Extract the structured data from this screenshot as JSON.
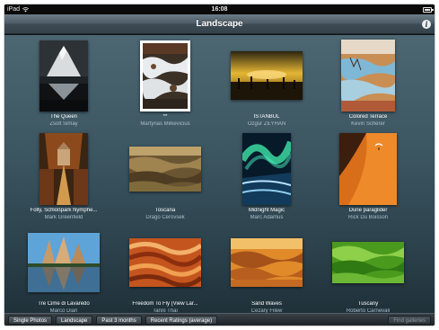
{
  "statusbar": {
    "carrier": "iPad",
    "time": "16:08"
  },
  "navbar": {
    "title": "Landscape",
    "info_icon": "i"
  },
  "photos": [
    {
      "title": "The Queen",
      "author": "Zsolt Simay"
    },
    {
      "title": "**",
      "author": "Martynas Milkevicius"
    },
    {
      "title": "İSTANBUL",
      "author": "Özgür ZEYHAN"
    },
    {
      "title": "Colored Terrace",
      "author": "Kevin Scherer"
    },
    {
      "title": "Folly, Schloßpark Nymphe...",
      "author": "Mark Greenfield"
    },
    {
      "title": "Toscana",
      "author": "Drago Cerovsek"
    },
    {
      "title": "Midnight Magic",
      "author": "Marc Adamus"
    },
    {
      "title": "Dune paraglider",
      "author": "Rick Du Boisson"
    },
    {
      "title": "Tre Cime di Lavaredo",
      "author": "Marco Dian"
    },
    {
      "title": "Freedom To Fly (View Lar...",
      "author": "Tanni Thai"
    },
    {
      "title": "Sand Waves",
      "author": "Cezary Filew"
    },
    {
      "title": "Tuscany",
      "author": "Roberto Carnevali"
    }
  ],
  "toolbar": {
    "single_photos": "Single Photos",
    "landscape": "Landscape",
    "past_3_months": "Past 3 months",
    "recent_ratings": "Recent Ratings (average)",
    "find_galleries": "Find galleries"
  }
}
